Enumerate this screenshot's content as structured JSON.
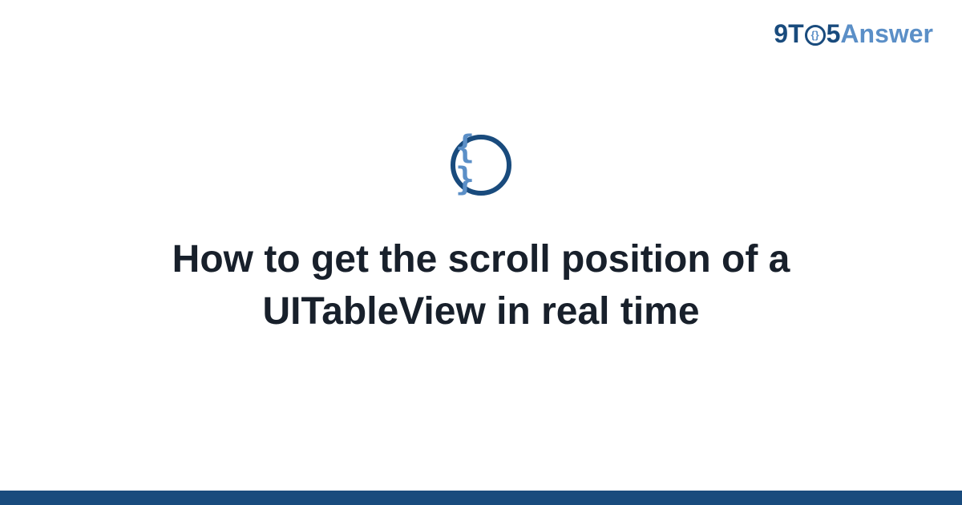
{
  "brand": {
    "part1": "9T",
    "circle_inner": "{}",
    "part2": "5",
    "part3": "Answer"
  },
  "badge": {
    "symbol": "{ }"
  },
  "title": "How to get the scroll position of a UITableView in real time"
}
